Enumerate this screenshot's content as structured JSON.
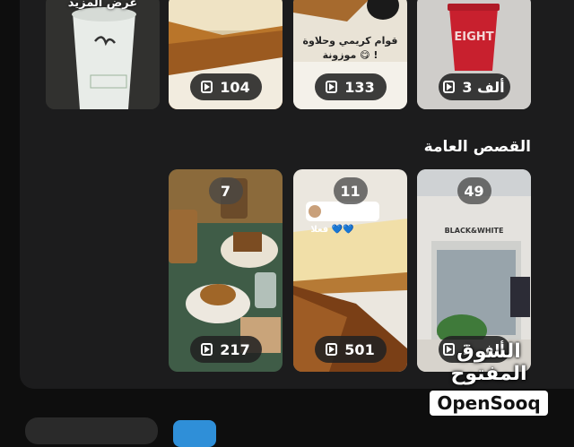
{
  "colors": {
    "background": "#0e0e0e",
    "panel": "#1c1c1d",
    "pill": "#222222",
    "accent_blue": "#2f8fd8",
    "cup_red": "#c8202e"
  },
  "top_row": [
    {
      "label": "عرض المزيد",
      "kind": "more"
    },
    {
      "views": "104"
    },
    {
      "views": "133",
      "story_text": "قوام كريمي وحلاوة موزونة 😋 !"
    },
    {
      "views": "3 ألف",
      "cup_text": "EIGHT"
    }
  ],
  "section": {
    "title": "القصص العامة"
  },
  "public_stories": [
    {
      "badge": "7",
      "views": "217"
    },
    {
      "badge": "11",
      "views": "501",
      "story_text": "فعلا 💙💙"
    },
    {
      "badge": "49",
      "views": "1 ألف",
      "brand_text": "BLACK&WHITE"
    }
  ],
  "icons": {
    "play": "play-icon"
  },
  "watermark": {
    "arabic": "السوق المفتوح",
    "latin": "OpenSooq"
  }
}
